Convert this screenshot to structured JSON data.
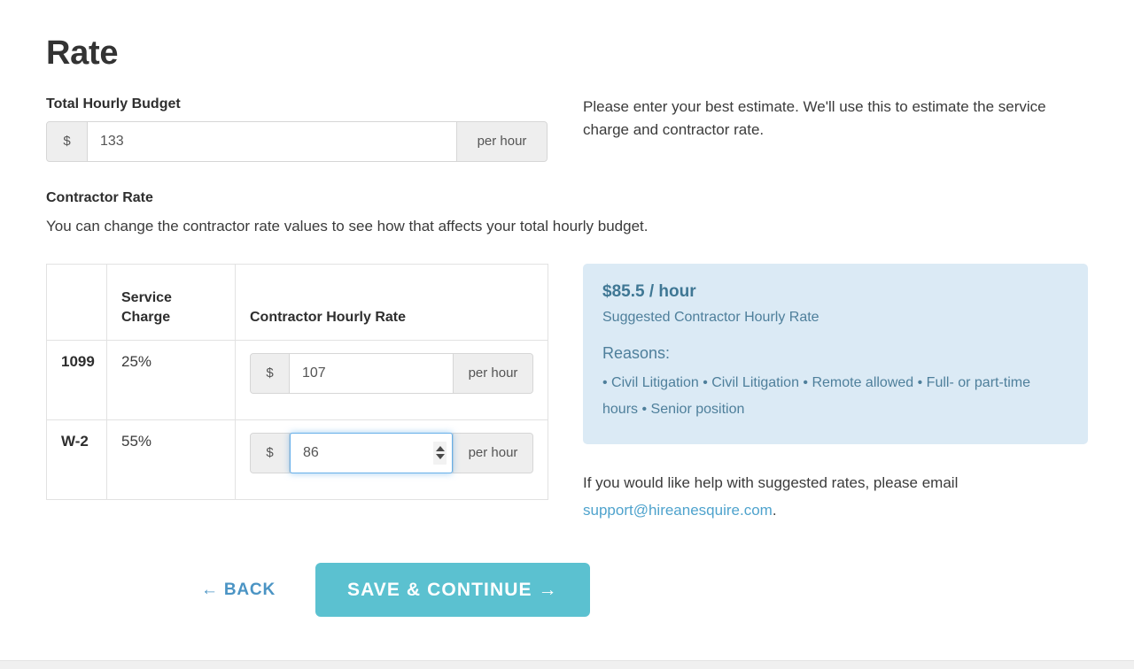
{
  "page": {
    "title": "Rate"
  },
  "budget": {
    "label": "Total Hourly Budget",
    "currency_symbol": "$",
    "value": "133",
    "placeholder": "",
    "unit_label": "per hour",
    "helper_text": "Please enter your best estimate. We'll use this to estimate the service charge and contractor rate."
  },
  "contractor": {
    "label": "Contractor Rate",
    "description": "You can change the contractor rate values to see how that affects your total hourly budget.",
    "table": {
      "headers": [
        "",
        "Service Charge",
        "Contractor Hourly Rate"
      ],
      "rows": [
        {
          "type": "1099",
          "service_charge": "25%",
          "currency_symbol": "$",
          "rate": "107",
          "unit_label": "per hour",
          "focused": false
        },
        {
          "type": "W-2",
          "service_charge": "55%",
          "currency_symbol": "$",
          "rate": "86",
          "unit_label": "per hour",
          "focused": true
        }
      ]
    }
  },
  "suggestion": {
    "rate": "$85.5 / hour",
    "subtitle": "Suggested Contractor Hourly Rate",
    "reasons_label": "Reasons:",
    "reasons_text": "• Civil Litigation • Civil Litigation • Remote allowed • Full- or part-time hours • Senior position",
    "reasons_list": [
      "Civil Litigation",
      "Civil Litigation",
      "Remote allowed",
      "Full- or part-time hours",
      "Senior position"
    ],
    "background_color": "#dbeaf5",
    "text_color": "#4e7f9b"
  },
  "support": {
    "text_before": "If you would like help with suggested rates, please email ",
    "email": "support@hireanesquire.com",
    "text_after": ".",
    "link_color": "#4fa3cd"
  },
  "actions": {
    "back_label": "← BACK",
    "save_label": "SAVE & CONTINUE →",
    "save_color": "#5bc1d0",
    "back_color": "#4b94c4"
  }
}
